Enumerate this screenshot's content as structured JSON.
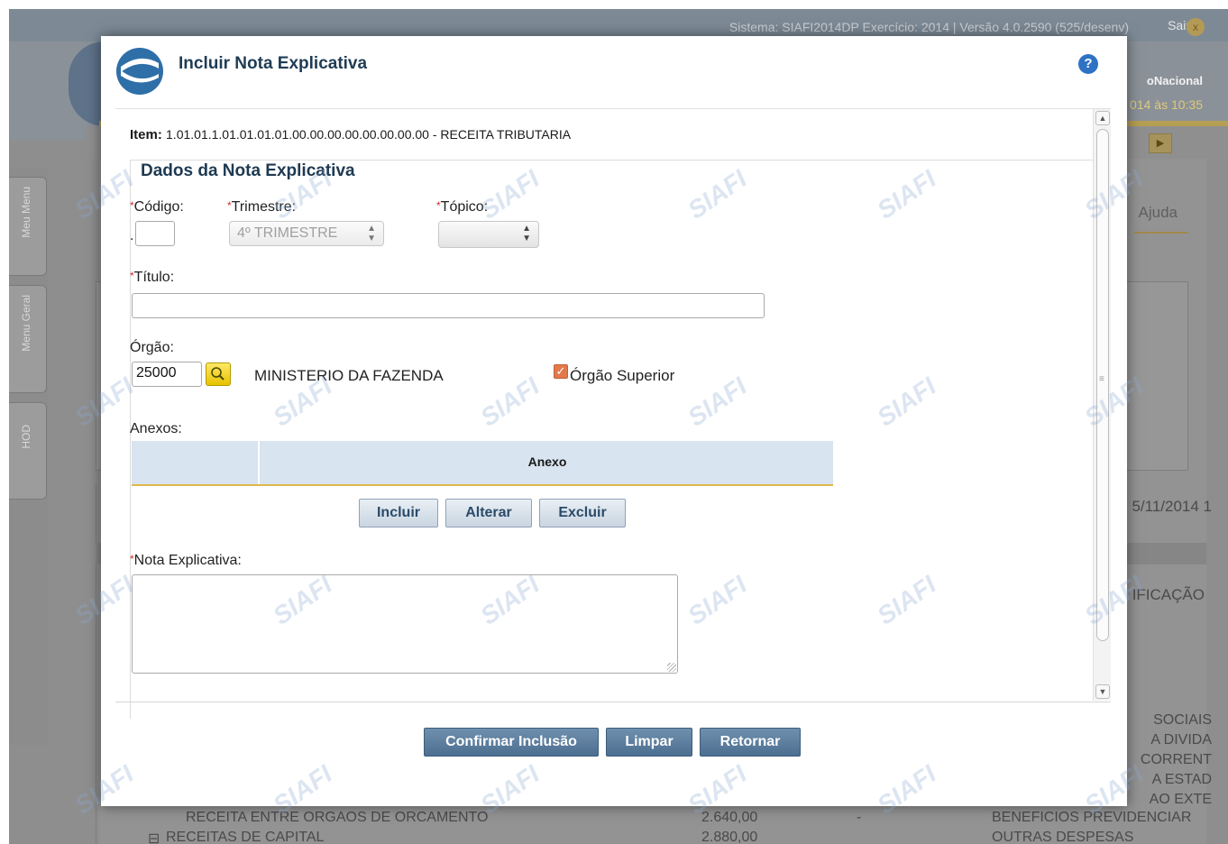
{
  "background": {
    "system_info": "Sistema: SIAFI2014DP Exercício: 2014 | Versão 4.0.2590 (525/desenv)",
    "exit_label": "Sair",
    "brand_fragment": "oNacional",
    "clock_fragment": "014 às 10:35",
    "help_tab": "Ajuda",
    "date_fragment": "5/11/2014 1",
    "classification_fragment": "IFICAÇÃO",
    "right_list": [
      "SOCIAIS",
      "A DIVIDA",
      "CORRENT",
      "A ESTAD",
      "AO EXTE",
      "BENEFICIOS PREVIDENCIAR",
      "OUTRAS DESPESAS"
    ],
    "row1": {
      "label": "RECEITA ENTRE ORGAOS DE ORCAMENTO",
      "value": "2.640,00",
      "dash": "-"
    },
    "row2": {
      "label": "RECEITAS DE CAPITAL",
      "value": "2.880,00"
    },
    "side_tabs": [
      "Meu Menu",
      "Menu Geral",
      "HOD"
    ]
  },
  "watermark": "SIAFI",
  "modal": {
    "title": "Incluir Nota Explicativa",
    "help_icon_text": "?",
    "item_label": "Item:",
    "item_value": "1.01.01.1.01.01.01.01.00.00.00.00.00.00.00.00 - RECEITA TRIBUTARIA",
    "section_title": "Dados da Nota Explicativa",
    "required_mark": "*",
    "codigo": {
      "label": "Código:",
      "prefix": ".",
      "value": ""
    },
    "trimestre": {
      "label": "Trimestre:",
      "value": "4º TRIMESTRE"
    },
    "topico": {
      "label": "Tópico:",
      "value": ""
    },
    "titulo": {
      "label": "Título:",
      "value": ""
    },
    "orgao": {
      "label": "Órgão:",
      "code": "25000",
      "name": "MINISTERIO DA FAZENDA",
      "superior_label": "Órgão Superior",
      "superior_checked": true
    },
    "anexos": {
      "label": "Anexos:",
      "column": "Anexo"
    },
    "anexo_buttons": [
      "Incluir",
      "Alterar",
      "Excluir"
    ],
    "nota": {
      "label": "Nota Explicativa:",
      "value": ""
    },
    "footer_buttons": [
      "Confirmar Inclusão",
      "Limpar",
      "Retornar"
    ]
  }
}
